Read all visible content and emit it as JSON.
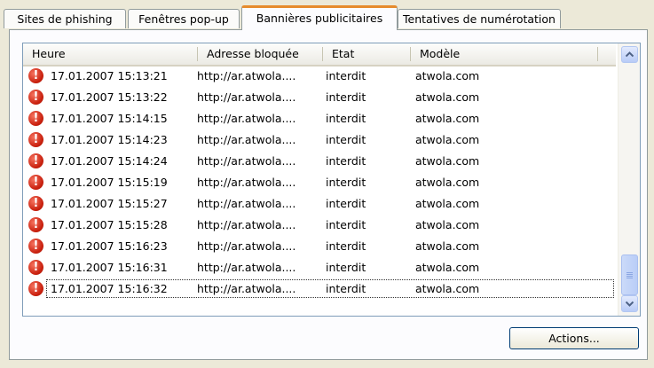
{
  "tabs": [
    {
      "label": "Sites de phishing"
    },
    {
      "label": "Fenêtres pop-up"
    },
    {
      "label": "Bannières publicitaires"
    },
    {
      "label": "Tentatives de numérotation"
    }
  ],
  "active_tab": "Bannières publicitaires",
  "table": {
    "columns": [
      "Heure",
      "Adresse bloquée",
      "Etat",
      "Modèle"
    ],
    "rows": [
      {
        "heure": "17.01.2007 15:13:21",
        "adresse": "http://ar.atwola....",
        "etat": "interdit",
        "modele": "atwola.com"
      },
      {
        "heure": "17.01.2007 15:13:22",
        "adresse": "http://ar.atwola....",
        "etat": "interdit",
        "modele": "atwola.com"
      },
      {
        "heure": "17.01.2007 15:14:15",
        "adresse": "http://ar.atwola....",
        "etat": "interdit",
        "modele": "atwola.com"
      },
      {
        "heure": "17.01.2007 15:14:23",
        "adresse": "http://ar.atwola....",
        "etat": "interdit",
        "modele": "atwola.com"
      },
      {
        "heure": "17.01.2007 15:14:24",
        "adresse": "http://ar.atwola....",
        "etat": "interdit",
        "modele": "atwola.com"
      },
      {
        "heure": "17.01.2007 15:15:19",
        "adresse": "http://ar.atwola....",
        "etat": "interdit",
        "modele": "atwola.com"
      },
      {
        "heure": "17.01.2007 15:15:27",
        "adresse": "http://ar.atwola....",
        "etat": "interdit",
        "modele": "atwola.com"
      },
      {
        "heure": "17.01.2007 15:15:28",
        "adresse": "http://ar.atwola....",
        "etat": "interdit",
        "modele": "atwola.com"
      },
      {
        "heure": "17.01.2007 15:16:23",
        "adresse": "http://ar.atwola....",
        "etat": "interdit",
        "modele": "atwola.com"
      },
      {
        "heure": "17.01.2007 15:16:31",
        "adresse": "http://ar.atwola....",
        "etat": "interdit",
        "modele": "atwola.com"
      },
      {
        "heure": "17.01.2007 15:16:32",
        "adresse": "http://ar.atwola....",
        "etat": "interdit",
        "modele": "atwola.com"
      }
    ],
    "row_icon": "error-icon",
    "focused_row": 10
  },
  "actions_button": {
    "label": "Actions..."
  },
  "colors": {
    "active_tab_accent": "#e68b2c",
    "error_icon": "#c9200e"
  }
}
